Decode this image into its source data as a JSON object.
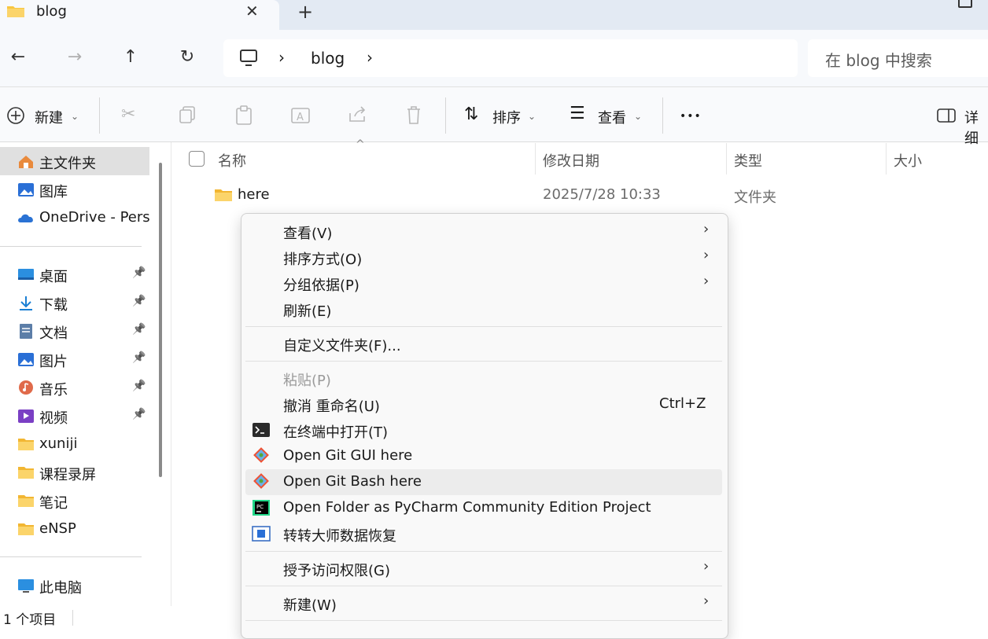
{
  "tab": {
    "title": "blog"
  },
  "address": {
    "crumbs": [
      "blog"
    ]
  },
  "search": {
    "placeholder": "在 blog 中搜索"
  },
  "toolbar": {
    "new_label": "新建",
    "sort_label": "排序",
    "view_label": "查看",
    "more_label": "•••",
    "details_label": "详细"
  },
  "sidebar": {
    "items": [
      {
        "label": "主文件夹",
        "icon": "home-icon"
      },
      {
        "label": "图库",
        "icon": "gallery-icon"
      },
      {
        "label": "OneDrive - Perso",
        "icon": "onedrive-icon"
      },
      {
        "label": "桌面",
        "icon": "desktop-icon",
        "pinned": true
      },
      {
        "label": "下载",
        "icon": "download-icon",
        "pinned": true
      },
      {
        "label": "文档",
        "icon": "documents-icon",
        "pinned": true
      },
      {
        "label": "图片",
        "icon": "pictures-icon",
        "pinned": true
      },
      {
        "label": "音乐",
        "icon": "music-icon",
        "pinned": true
      },
      {
        "label": "视频",
        "icon": "videos-icon",
        "pinned": true
      },
      {
        "label": "xuniji",
        "icon": "folder-icon"
      },
      {
        "label": "课程录屏",
        "icon": "folder-icon"
      },
      {
        "label": "笔记",
        "icon": "folder-icon"
      },
      {
        "label": "eNSP",
        "icon": "folder-icon"
      },
      {
        "label": "此电脑",
        "icon": "computer-icon"
      }
    ]
  },
  "filelist": {
    "columns": [
      "名称",
      "修改日期",
      "类型",
      "大小"
    ],
    "rows": [
      {
        "name": "here",
        "date": "2025/7/28 10:33",
        "type": "文件夹",
        "size": ""
      }
    ]
  },
  "status": {
    "text": "1 个项目"
  },
  "context_menu": {
    "items": [
      {
        "label": "查看(V)",
        "submenu": true
      },
      {
        "label": "排序方式(O)",
        "submenu": true
      },
      {
        "label": "分组依据(P)",
        "submenu": true
      },
      {
        "label": "刷新(E)"
      },
      {
        "label": "自定义文件夹(F)..."
      },
      {
        "label": "粘贴(P)",
        "disabled": true
      },
      {
        "label": "撤消 重命名(U)",
        "shortcut": "Ctrl+Z"
      },
      {
        "label": "在终端中打开(T)",
        "icon": "terminal-icon"
      },
      {
        "label": "Open Git GUI here",
        "icon": "git-icon"
      },
      {
        "label": "Open Git Bash here",
        "icon": "git-icon",
        "highlighted": true
      },
      {
        "label": "Open Folder as PyCharm Community Edition Project",
        "icon": "pycharm-icon"
      },
      {
        "label": "转转大师数据恢复",
        "icon": "recovery-app-icon"
      },
      {
        "label": "授予访问权限(G)",
        "submenu": true
      },
      {
        "label": "新建(W)",
        "submenu": true
      }
    ]
  },
  "colors": {
    "accent": "#0067c0",
    "folder": "#f8c640",
    "menu_bg": "#f9f9f9"
  }
}
